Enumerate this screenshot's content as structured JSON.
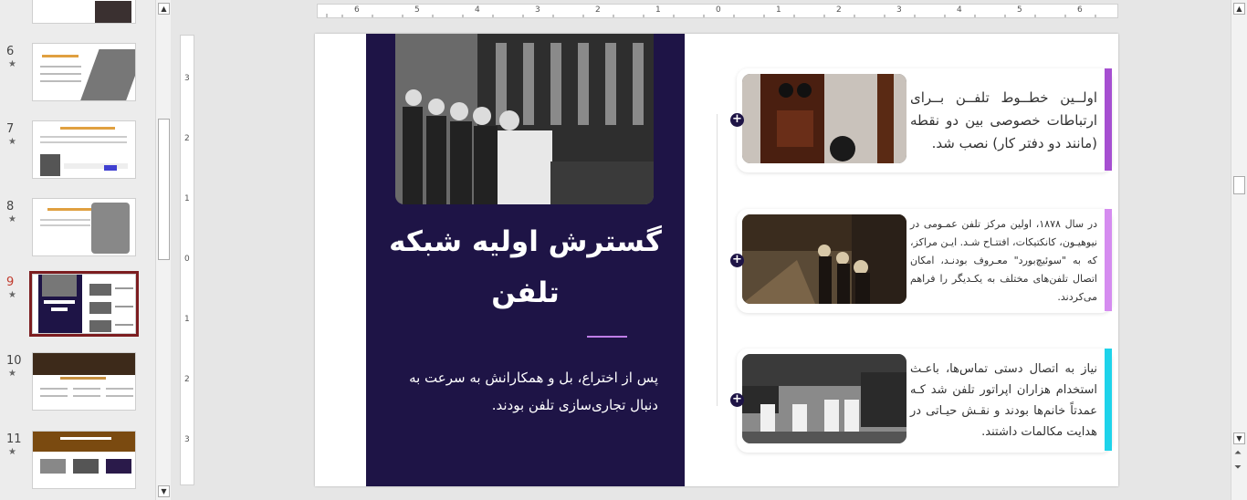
{
  "thumbnails": [
    {
      "num": "6",
      "star": "★",
      "selected": false,
      "variant": "light"
    },
    {
      "num": "7",
      "star": "★",
      "selected": false,
      "variant": "light"
    },
    {
      "num": "8",
      "star": "★",
      "selected": false,
      "variant": "light"
    },
    {
      "num": "9",
      "star": "★",
      "selected": true,
      "variant": "dark"
    },
    {
      "num": "10",
      "star": "★",
      "selected": false,
      "variant": "brown"
    },
    {
      "num": "11",
      "star": "★",
      "selected": false,
      "variant": "gold"
    }
  ],
  "ruler": {
    "h_labels": [
      "6",
      "5",
      "4",
      "3",
      "2",
      "1",
      "0",
      "1",
      "2",
      "3",
      "4",
      "5",
      "6"
    ],
    "v_labels": [
      "3",
      "2",
      "1",
      "0",
      "1",
      "2",
      "3"
    ]
  },
  "slide": {
    "title": "گسترش اولیه شبکه تلفن",
    "body": "پس از اختراع، بل و همکارانش به سرعت به دنبال تجاری‌سازی تلفن بودند.",
    "cards": [
      {
        "text": "اولــین خطــوط تلفــن بــرای ارتباطات خصوصی بین دو نقطه (مانند دو دفتر کار) نصب شد.",
        "accent": "#a64fd1"
      },
      {
        "text": "در سال ۱۸۷۸، اولین مرکز تلفن عمـومی در نیوهیـون، کانکتیکات، افتتـاح شـد. ایـن مراکز، که به \"سوئیچ‌بورد\" معـروف بودنـد، امکان اتصال تلفن‌های مختلف به یکـدیگر را فراهم می‌کردند.",
        "accent": "#d58cf0"
      },
      {
        "text": "نیاز به اتصال دستی تماس‌ها، باعـث استخدام هزاران اپراتور تلفن شد کـه عمدتاً خانم‌ها بودند و نقـش حیـاتی در هدایت مکالمات داشتند.",
        "accent": "#1ed3ea"
      }
    ]
  },
  "colors": {
    "panel": "#1e1446",
    "selected_outline": "#7c1d20",
    "accent_line": "#c07ee8"
  }
}
